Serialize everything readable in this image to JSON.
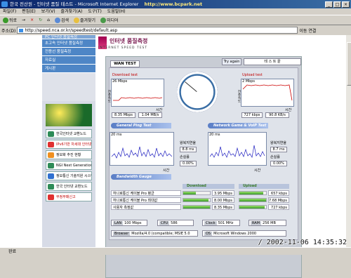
{
  "window": {
    "title": "한국 전산원 - 인터넷 품질 테스트 - Microsoft Internet Explorer"
  },
  "watermark": "http://www.bcpark.net",
  "menu": [
    "파일(F)",
    "편집(E)",
    "보기(V)",
    "즐겨찾기(A)",
    "도구(T)",
    "도움말(H)"
  ],
  "toolbar": {
    "back": "뒤로",
    "forward": "→",
    "stop": "×",
    "refresh": "↻",
    "home": "⌂",
    "search": "검색",
    "favorites": "즐겨찾기",
    "history": "미디어"
  },
  "address": {
    "label": "주소(D)",
    "url": "http://speed.nca.or.kr/speedtest/default.asp",
    "go": "이동",
    "links": "연결"
  },
  "nav": {
    "items": [
      "PC 인터넷 품질측정",
      "초고속 인터넷 품질측정",
      "전용선 품질측정",
      "자료실",
      "게시판"
    ],
    "banners": [
      "한국인터넷 교환노드",
      "IPv6기반 차세대 인터넷망",
      "정보화 추진 현황",
      "NGI Next Generation",
      "정보통신 기술지원 시스템",
      "한국 인터넷 교환노드",
      "부정부패신고"
    ]
  },
  "logo": {
    "title": "인터넷 품질측정",
    "subtitle": "INTERNET SPEED TEST"
  },
  "wan_tab": "WAN TEST",
  "try_again": "Try again",
  "test_status": "테 스 트 끝",
  "download": {
    "label": "Download test",
    "max": "26 Mbps",
    "time": "시간",
    "speed_mbps": "8.35 Mbps",
    "speed_mb": "1.04 MB/s",
    "yaxis": "전송속도"
  },
  "upload": {
    "label": "Upload test",
    "max": "2 Mbps",
    "time": "시간",
    "speed_kbps": "727 kbps",
    "speed_kb": "90.8 KB/s",
    "yaxis": "전송속도"
  },
  "ping": {
    "header": "General Ping Test",
    "max": "20 ms",
    "time": "시간",
    "rtt_label": "왕복지연율",
    "rtt": "8.8 ms",
    "loss_label": "손실률",
    "loss": "0.00%"
  },
  "game": {
    "header": "Network Game & VoIP Test",
    "max": "20 ms",
    "time": "시간",
    "rtt_label": "왕복지연율",
    "rtt": "8.7 ms",
    "loss_label": "손실률",
    "loss": "0.00%"
  },
  "bandwidth": {
    "header": "Bandwidth Gauge",
    "download_label": "Download",
    "upload_label": "Upload",
    "rows": [
      {
        "label": "하나로통신 케이블 Pro 평균",
        "dl": "3.95 Mbps",
        "dl_frac": 0.48,
        "ul": "657 kbps",
        "ul_frac": 0.9
      },
      {
        "label": "하나로통신 케이블 Pro 최대값",
        "dl": "8.00 Mbps",
        "dl_frac": 0.96,
        "ul": "7.68 Mbps",
        "ul_frac": 1.0
      },
      {
        "label": "사용자 측정값",
        "dl": "8.35 Mbps",
        "dl_frac": 1.0,
        "ul": "727 kbps",
        "ul_frac": 0.95
      }
    ]
  },
  "sysinfo": {
    "lan_label": "LAN",
    "lan": "100 Mbps",
    "cpu_label": "CPU",
    "cpu": "586",
    "clock_label": "Clock",
    "clock": "501 MHz",
    "ram_label": "RAM",
    "ram": "256 MB",
    "browser_label": "Browser",
    "browser": "Mozilla/4.0 (compatible; MSIE 5.0",
    "os_label": "OS",
    "os": "Microsoft Windows 2000"
  },
  "status": {
    "text": "완료",
    "timestamp": "2002-11-06 14:35:32"
  },
  "colors": {
    "title_bar": "#0a246a",
    "nav": "#4e86c6",
    "graph_line": "#2020c0",
    "bar": "#3a9a2a",
    "accent_red": "#c00000"
  }
}
